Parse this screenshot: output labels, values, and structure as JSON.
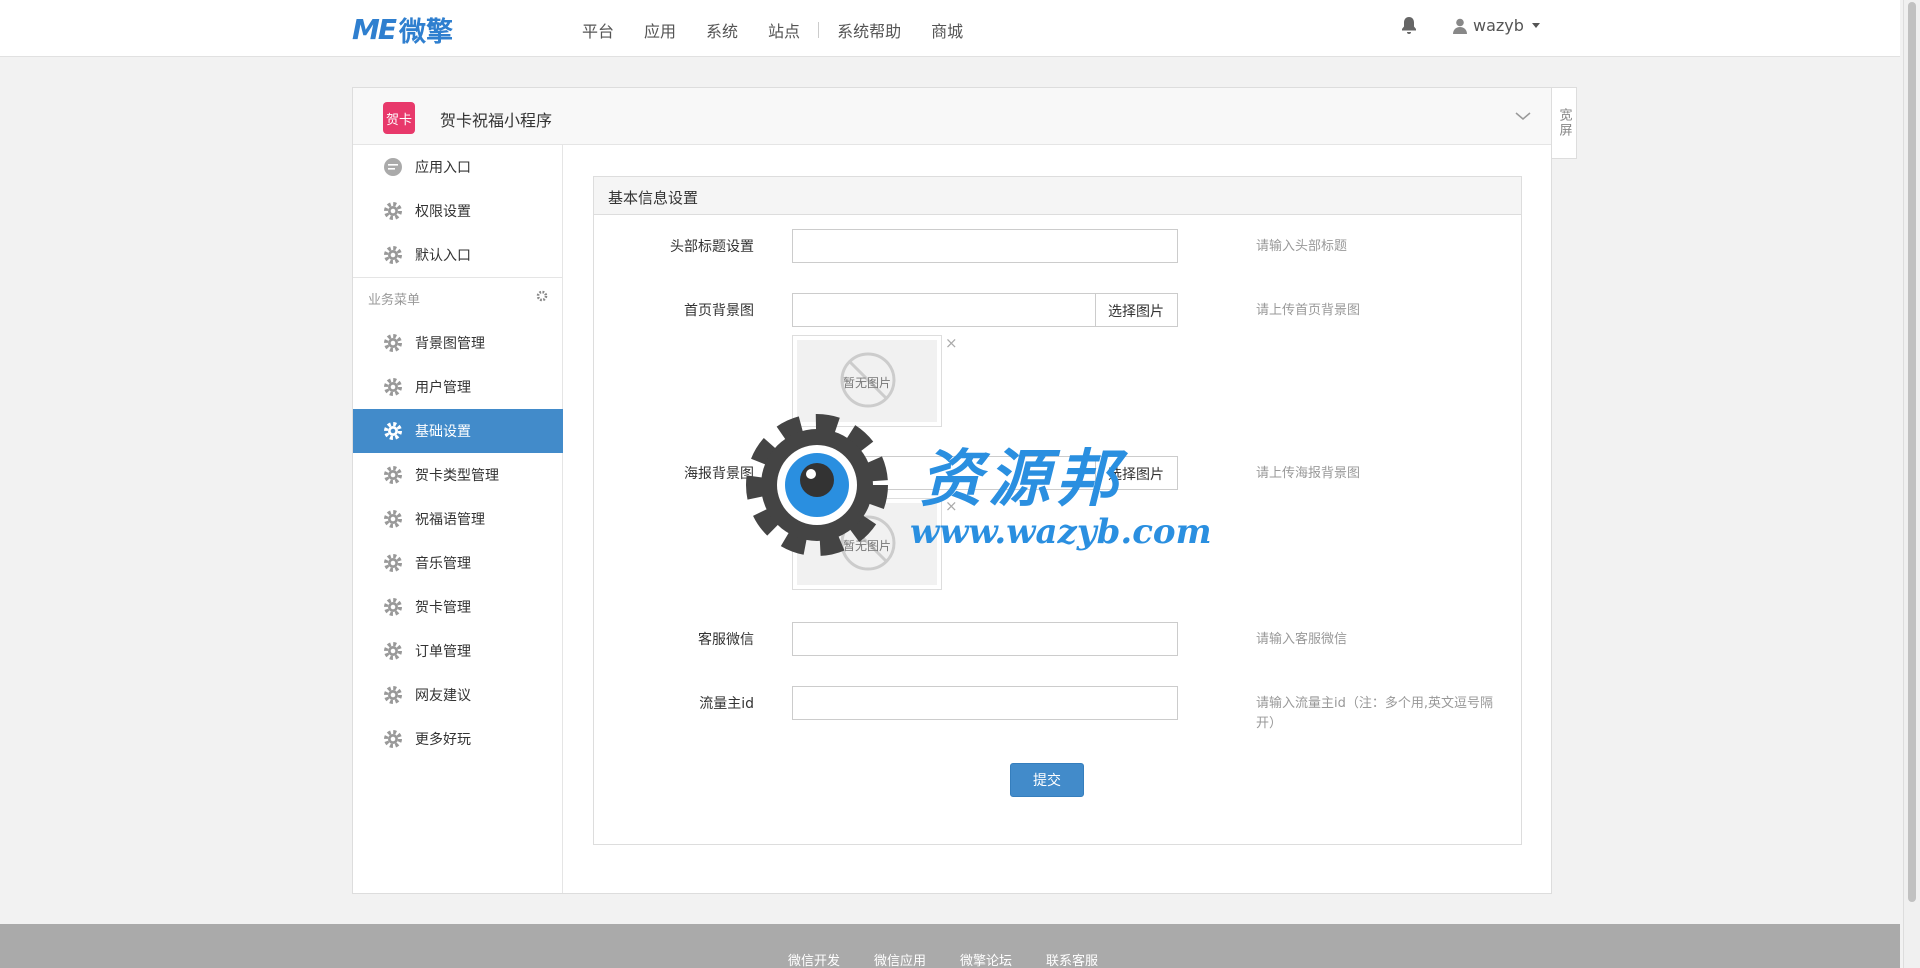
{
  "header": {
    "logo_mark": "ME",
    "logo_text": "微擎",
    "nav": [
      "平台",
      "应用",
      "系统",
      "站点",
      "系统帮助",
      "商城"
    ],
    "username": "wazyb"
  },
  "panel": {
    "app_icon_text": "贺卡",
    "app_title": "贺卡祝福小程序",
    "wide_button": "宽屏"
  },
  "sidebar": {
    "top_items": [
      "应用入口",
      "权限设置",
      "默认入口"
    ],
    "group_label": "业务菜单",
    "items": [
      "背景图管理",
      "用户管理",
      "基础设置",
      "贺卡类型管理",
      "祝福语管理",
      "音乐管理",
      "贺卡管理",
      "订单管理",
      "网友建议",
      "更多好玩"
    ],
    "active_index": 2
  },
  "form": {
    "title": "基本信息设置",
    "fields": {
      "header_title": {
        "label": "头部标题设置",
        "value": "",
        "hint": "请输入头部标题"
      },
      "home_bg": {
        "label": "首页背景图",
        "value": "",
        "button": "选择图片",
        "hint": "请上传首页背景图",
        "thumb_text": "暂无图片"
      },
      "poster_bg": {
        "label": "海报背景图",
        "value": "",
        "button": "选择图片",
        "hint": "请上传海报背景图",
        "thumb_text": "暂无图片"
      },
      "service_wechat": {
        "label": "客服微信",
        "value": "",
        "hint": "请输入客服微信"
      },
      "traffic_id": {
        "label": "流量主id",
        "value": "",
        "hint": "请输入流量主id（注：多个用,英文逗号隔开）"
      }
    },
    "close_glyph": "×",
    "submit": "提交"
  },
  "watermark": {
    "title": "资源邦",
    "url": "www.wazyb.com"
  },
  "footer": {
    "links": [
      "微信开发",
      "微信应用",
      "微擎论坛",
      "联系客服"
    ]
  },
  "colors": {
    "primary": "#428bca",
    "brand": "#2f7fcf",
    "app_icon": "#e8396b"
  }
}
